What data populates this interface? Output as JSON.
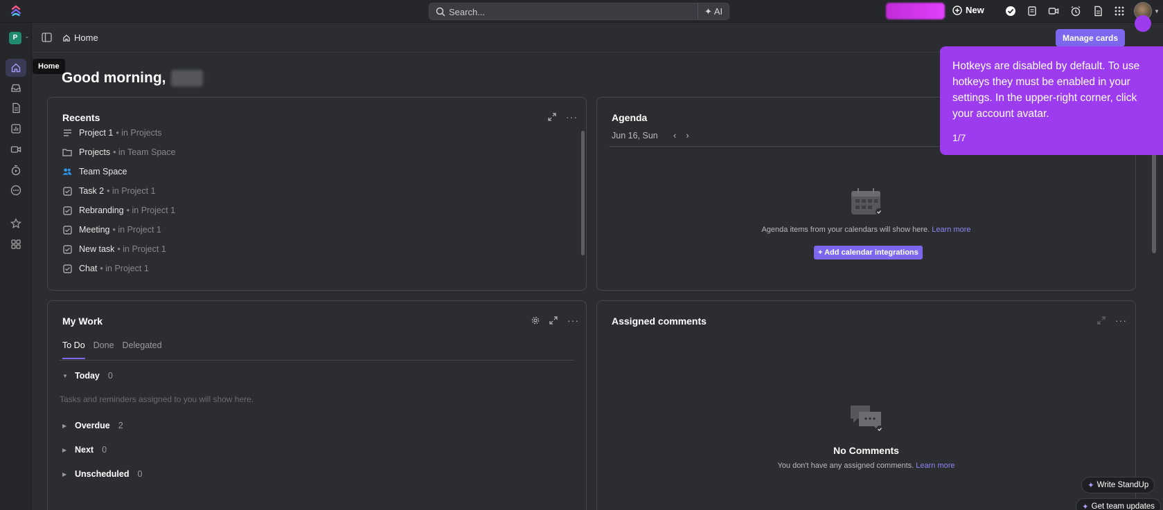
{
  "topbar": {
    "search_placeholder": "Search...",
    "ai_label": "AI",
    "new_label": "New"
  },
  "rail": {
    "workspace_initial": "P",
    "tooltip": "Home"
  },
  "header": {
    "breadcrumb": "Home",
    "manage_cards": "Manage cards"
  },
  "greeting": "Good morning,",
  "recents": {
    "title": "Recents",
    "items": [
      {
        "name": "Project 1",
        "location": "• in Projects",
        "icon": "list-icon"
      },
      {
        "name": "Projects",
        "location": "• in Team Space",
        "icon": "folder-icon"
      },
      {
        "name": "Team Space",
        "location": "",
        "icon": "people-icon"
      },
      {
        "name": "Task 2",
        "location": "• in Project 1",
        "icon": "checkbox-icon"
      },
      {
        "name": "Rebranding",
        "location": "• in Project 1",
        "icon": "checkbox-icon"
      },
      {
        "name": "Meeting",
        "location": "• in Project 1",
        "icon": "checkbox-icon"
      },
      {
        "name": "New task",
        "location": "• in Project 1",
        "icon": "checkbox-icon"
      },
      {
        "name": "Chat",
        "location": "• in Project 1",
        "icon": "checkbox-icon"
      }
    ]
  },
  "agenda": {
    "title": "Agenda",
    "date": "Jun 16, Sun",
    "empty_text": "Agenda items from your calendars will show here.",
    "learn_more": "Learn more",
    "add_button": "Add calendar integrations"
  },
  "my_work": {
    "title": "My Work",
    "tabs": [
      "To Do",
      "Done",
      "Delegated"
    ],
    "empty_text": "Tasks and reminders assigned to you will show here.",
    "groups": [
      {
        "label": "Today",
        "count": "0",
        "expanded": true
      },
      {
        "label": "Overdue",
        "count": "2",
        "expanded": false
      },
      {
        "label": "Next",
        "count": "0",
        "expanded": false
      },
      {
        "label": "Unscheduled",
        "count": "0",
        "expanded": false
      }
    ]
  },
  "assigned_comments": {
    "title": "Assigned comments",
    "empty_title": "No Comments",
    "empty_sub": "You don't have any assigned comments.",
    "learn_more": "Learn more"
  },
  "hotkey_popup": {
    "text": "Hotkeys are disabled by default. To use hotkeys they must be enabled in your settings. In the upper-right corner, click your account avatar.",
    "step": "1/7"
  },
  "floating": {
    "write_standup": "Write StandUp",
    "team_updates": "Get team updates"
  },
  "colors": {
    "accent": "#7b68ee",
    "popup": "#9c3cee",
    "background": "#2b2d31"
  }
}
